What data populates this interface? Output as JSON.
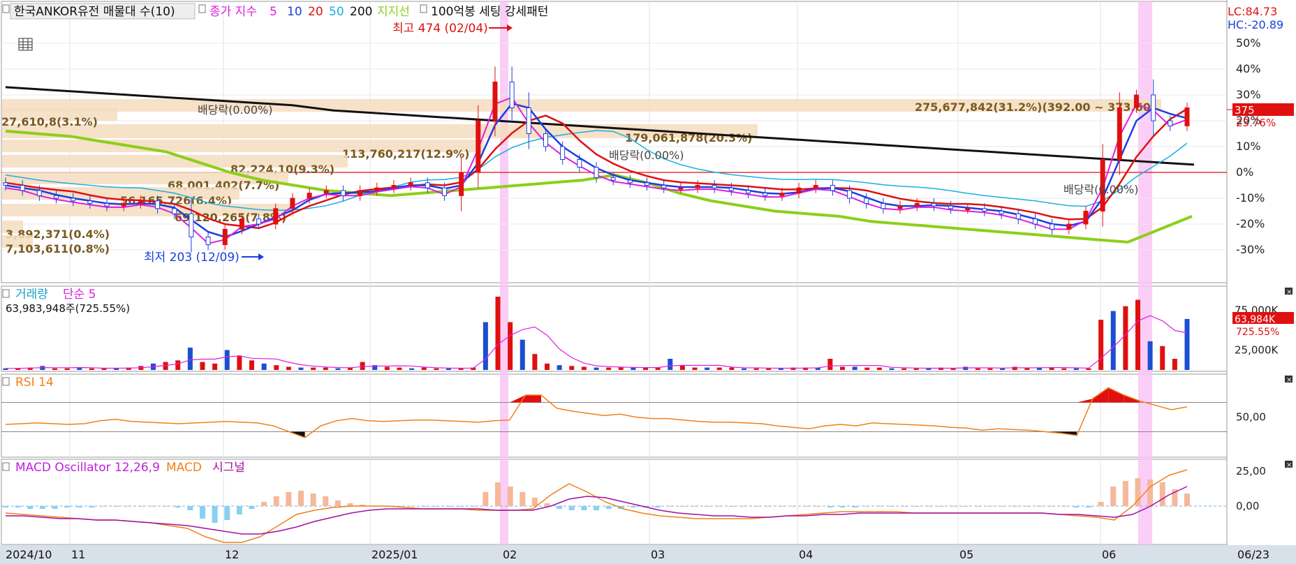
{
  "chart_data": [
    {
      "type": "candlestick",
      "panel": "price",
      "legend": {
        "title": "한국ANKOR유전 매물대 수(10)",
        "close_ma": "종가 지수",
        "ma_5": "5",
        "ma_10": "10",
        "ma_20": "20",
        "ma_50": "50",
        "ma_200": "200",
        "support": "지지선",
        "setting": "100억봉 세팅 강세패턴"
      },
      "y_ticks": [
        "50%",
        "40%",
        "30%",
        "20%",
        "10%",
        "0%",
        "-10%",
        "-20%",
        "-30%"
      ],
      "y_tick_values": [
        50,
        40,
        30,
        20,
        10,
        0,
        -10,
        -20,
        -30
      ],
      "lc": "LC:84.73",
      "hc": "HC:-20.89",
      "high_marker": "최고 474 (02/04)",
      "low_marker": "최저 203 (12/09)",
      "current_price": "375",
      "current_pct": "23.76%",
      "current_pct_value": 23.76,
      "dividend_markers": [
        "배당락(0.00%)",
        "배당락(0.00%)",
        "배당락(0.00%)"
      ],
      "volume_profile": [
        {
          "label": "275,677,842(31.2%)(392.00 ~ 373.60)",
          "pct": 31.2
        },
        {
          "label": "179,061,878(20.3%)",
          "pct": 20.3
        },
        {
          "label": "113,760,217(12.9%)",
          "pct": 12.9
        },
        {
          "label": "82,224,10(9.3%)",
          "pct": 9.3
        },
        {
          "label": "68,001,402(7.7%)",
          "pct": 7.7
        },
        {
          "label": "27,610,8(3.1%)",
          "pct": 3.1
        },
        {
          "label": "56,165,726(6.4%)",
          "pct": 6.4
        },
        {
          "label": "69,120,265(7.8%)",
          "pct": 7.8
        },
        {
          "label": "3,892,371(0.4%)",
          "pct": 0.4
        },
        {
          "label": "7,103,611(0.8%)",
          "pct": 0.8
        }
      ],
      "x_labels": [
        "2024/10",
        "11",
        "12",
        "2025/01",
        "02",
        "03",
        "04",
        "05",
        "06",
        "06/23"
      ],
      "close_pct": [
        -5,
        -7,
        -9,
        -10,
        -11,
        -12,
        -13,
        -12,
        -11,
        -14,
        -16,
        -25,
        -28,
        -22,
        -18,
        -20,
        -14,
        -10,
        -8,
        -7,
        -9,
        -7,
        -6,
        -5,
        -4,
        -6,
        -9,
        0,
        20,
        35,
        25,
        15,
        10,
        5,
        2,
        -2,
        -3,
        -4,
        -5,
        -6,
        -6,
        -5,
        -6,
        -7,
        -8,
        -9,
        -8,
        -6,
        -5,
        -7,
        -10,
        -12,
        -14,
        -13,
        -12,
        -13,
        -14,
        -14,
        -15,
        -16,
        -18,
        -20,
        -22,
        -20,
        -15,
        5,
        25,
        30,
        20,
        18,
        25
      ],
      "ma_black_pct": [
        33,
        32,
        31,
        30,
        29,
        28,
        27,
        26,
        24,
        23,
        22,
        21,
        20,
        19,
        18,
        17,
        16,
        15,
        14,
        13,
        12,
        11,
        10,
        9,
        8,
        7,
        6,
        5,
        4,
        3
      ],
      "ma_green_pct": [
        16,
        15,
        14,
        12,
        10,
        8,
        4,
        0,
        -3,
        -5,
        -7,
        -8,
        -9,
        -8,
        -7,
        -6,
        -5,
        -4,
        -3,
        -1,
        -4,
        -8,
        -11,
        -13,
        -15,
        -16,
        -17,
        -19,
        -20,
        -21,
        -22,
        -23,
        -24,
        -25,
        -26,
        -27,
        -22,
        -17
      ]
    },
    {
      "type": "bar",
      "panel": "volume",
      "legend": {
        "title": "거래량",
        "ma": "단순 5"
      },
      "summary": "63,983,948주(725.55%)",
      "y_ticks": [
        "75,000K",
        "25,000K"
      ],
      "y_tick_values": [
        75000,
        25000
      ],
      "current_value": "63,984K",
      "current_pct": "725.55%",
      "values_k": [
        2,
        2,
        3,
        5,
        2,
        2,
        3,
        2,
        2,
        2,
        3,
        5,
        8,
        10,
        12,
        28,
        10,
        8,
        25,
        18,
        12,
        8,
        6,
        4,
        3,
        3,
        3,
        2,
        3,
        10,
        6,
        4,
        3,
        2,
        3,
        2,
        2,
        2,
        3,
        60,
        92,
        60,
        38,
        20,
        8,
        6,
        5,
        4,
        3,
        3,
        3,
        3,
        3,
        3,
        14,
        6,
        3,
        3,
        3,
        3,
        2,
        2,
        2,
        2,
        3,
        3,
        3,
        14,
        4,
        4,
        3,
        3,
        2,
        2,
        2,
        2,
        3,
        2,
        4,
        2,
        2,
        2,
        4,
        3,
        3,
        3,
        2,
        2,
        2,
        63,
        74,
        80,
        88,
        36,
        30,
        14,
        64
      ]
    },
    {
      "type": "line",
      "panel": "rsi",
      "legend": {
        "title": "RSI 14"
      },
      "y_ticks": [
        "50,00"
      ],
      "y_tick_values": [
        50
      ],
      "values": [
        40,
        41,
        42,
        41,
        40,
        41,
        45,
        47,
        44,
        43,
        42,
        41,
        42,
        43,
        44,
        43,
        42,
        38,
        30,
        22,
        38,
        45,
        48,
        45,
        44,
        45,
        46,
        46,
        45,
        44,
        43,
        45,
        46,
        80,
        80,
        62,
        58,
        55,
        52,
        54,
        50,
        48,
        48,
        46,
        44,
        43,
        43,
        42,
        41,
        38,
        36,
        34,
        38,
        40,
        38,
        42,
        41,
        40,
        39,
        38,
        36,
        35,
        32,
        34,
        33,
        32,
        30,
        28,
        25,
        75,
        90,
        80,
        72,
        66,
        60,
        64
      ]
    },
    {
      "type": "bar+line",
      "panel": "macd",
      "legend": {
        "title": "MACD Oscillator 12,26,9",
        "macd": "MACD",
        "signal": "시그널"
      },
      "y_ticks": [
        "25,00",
        "0,00"
      ],
      "y_tick_values": [
        25,
        0
      ],
      "osc": [
        -1,
        -1,
        -2,
        -2,
        -2,
        -1,
        -1,
        -1,
        0,
        0,
        0,
        0,
        0,
        0,
        -1,
        -3,
        -9,
        -12,
        -10,
        -6,
        -2,
        3,
        7,
        10,
        11,
        9,
        7,
        4,
        2,
        1,
        0,
        0,
        0,
        0,
        0,
        0,
        0,
        0,
        0,
        10,
        17,
        14,
        10,
        6,
        2,
        -2,
        -3,
        -3,
        -3,
        -2,
        -2,
        -1,
        -1,
        -1,
        0,
        0,
        0,
        0,
        0,
        0,
        0,
        0,
        0,
        0,
        0,
        0,
        0,
        -1,
        -1,
        -1,
        0,
        0,
        0,
        0,
        0,
        0,
        0,
        0,
        0,
        0,
        0,
        0,
        0,
        0,
        0,
        0,
        0,
        -1,
        -1,
        3,
        14,
        18,
        20,
        19,
        17,
        12,
        9
      ],
      "macd": [
        -5,
        -6,
        -7,
        -8,
        -9,
        -10,
        -10,
        -11,
        -12,
        -14,
        -16,
        -22,
        -26,
        -26,
        -22,
        -14,
        -6,
        -3,
        -1,
        0,
        0,
        0,
        -1,
        -2,
        -2,
        -2,
        -3,
        -3,
        -3,
        -2,
        8,
        16,
        10,
        3,
        -2,
        -5,
        -7,
        -8,
        -9,
        -9,
        -9,
        -9,
        -8,
        -7,
        -6,
        -5,
        -4,
        -4,
        -4,
        -4,
        -5,
        -5,
        -5,
        -5,
        -5,
        -5,
        -5,
        -5,
        -6,
        -7,
        -8,
        -10,
        0,
        14,
        22,
        26
      ],
      "signal": [
        -7,
        -7,
        -8,
        -9,
        -9,
        -10,
        -10,
        -11,
        -12,
        -13,
        -14,
        -16,
        -18,
        -20,
        -20,
        -18,
        -15,
        -11,
        -8,
        -5,
        -3,
        -2,
        -2,
        -2,
        -2,
        -2,
        -2,
        -3,
        -3,
        -3,
        0,
        5,
        7,
        6,
        3,
        0,
        -3,
        -5,
        -6,
        -7,
        -7,
        -8,
        -8,
        -7,
        -7,
        -6,
        -6,
        -5,
        -5,
        -5,
        -5,
        -5,
        -5,
        -5,
        -5,
        -5,
        -5,
        -5,
        -6,
        -6,
        -7,
        -8,
        -6,
        0,
        8,
        14
      ]
    }
  ]
}
